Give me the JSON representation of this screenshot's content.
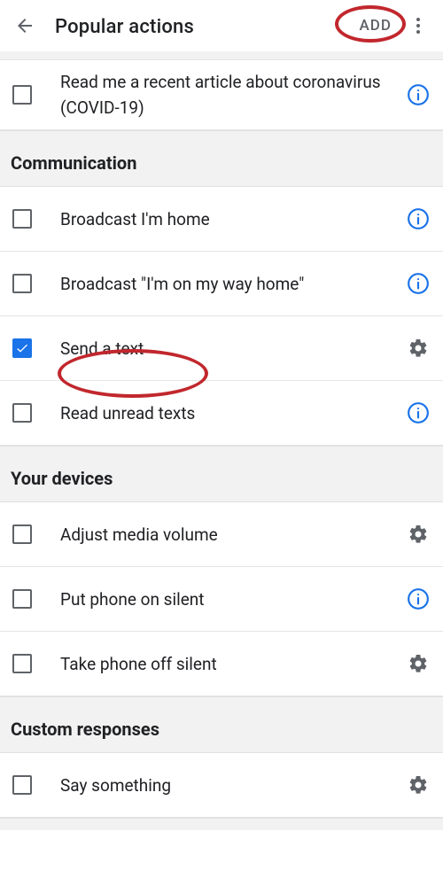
{
  "header": {
    "title": "Popular actions",
    "add_label": "ADD"
  },
  "sections": {
    "first_items": [
      {
        "label": "Read me a recent article about coronavirus (COVID-19)",
        "checked": false,
        "icon": "info"
      }
    ],
    "communication": {
      "title": "Communication",
      "items": [
        {
          "label": "Broadcast I'm home",
          "checked": false,
          "icon": "info"
        },
        {
          "label": "Broadcast \"I'm on my way home\"",
          "checked": false,
          "icon": "info"
        },
        {
          "label": "Send a text",
          "checked": true,
          "icon": "gear"
        },
        {
          "label": "Read unread texts",
          "checked": false,
          "icon": "info"
        }
      ]
    },
    "devices": {
      "title": "Your devices",
      "items": [
        {
          "label": "Adjust media volume",
          "checked": false,
          "icon": "gear"
        },
        {
          "label": "Put phone on silent",
          "checked": false,
          "icon": "info"
        },
        {
          "label": "Take phone off silent",
          "checked": false,
          "icon": "gear"
        }
      ]
    },
    "custom": {
      "title": "Custom responses",
      "items": [
        {
          "label": "Say something",
          "checked": false,
          "icon": "gear"
        }
      ]
    }
  }
}
